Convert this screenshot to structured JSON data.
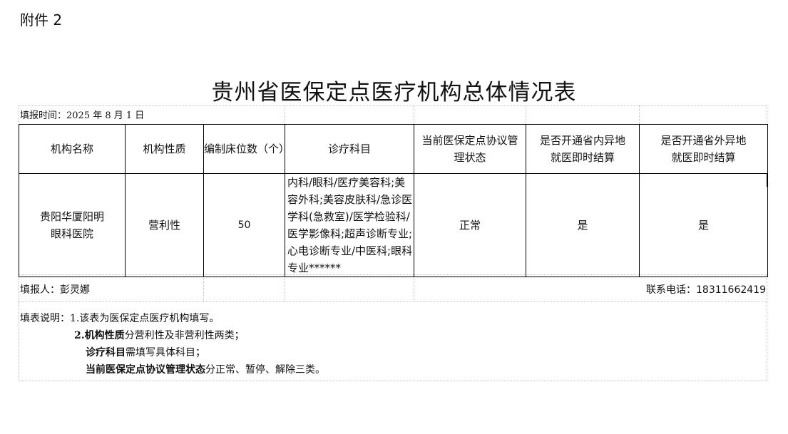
{
  "attachment_label": "附件 2",
  "title": "贵州省医保定点医疗机构总体情况表",
  "fill_date": "填报时间：2025 年 8 月 1 日",
  "table": {
    "headers": [
      "机构名称",
      "机构性质",
      "编制床位数（个）",
      "诊疗科目",
      "当前医保定点协议管理状态",
      "是否开通省内异地就医即时结算",
      "是否开通省外异地就医即时结算"
    ],
    "row": {
      "name": "贵阳华厦阳明眼科医院",
      "nature": "营利性",
      "beds": "50",
      "departments": "内科/眼科/医疗美容科;美容外科;美容皮肤科/急诊医学科(急救室)/医学检验科/医学影像科;超声诊断专业;心电诊断专业/中医科;眼科专业******",
      "status": "正常",
      "in_province": "是",
      "out_province": "是"
    }
  },
  "reporter": "填报人：彭灵娜",
  "phone_label": "联系电话：",
  "phone": "18311662419",
  "notes": {
    "prefix": "填表说明：",
    "n1": "1.该表为医保定点医疗机构填写。",
    "n2_num": "2.",
    "n2_bold": "机构性质",
    "n2_rest": "分营利性及非营利性两类；",
    "n3_bold": "诊疗科目",
    "n3_rest": "需填写具体科目；",
    "n4_bold": "当前医保定点协议管理状态",
    "n4_rest": "分正常、暂停、解除三类。"
  }
}
